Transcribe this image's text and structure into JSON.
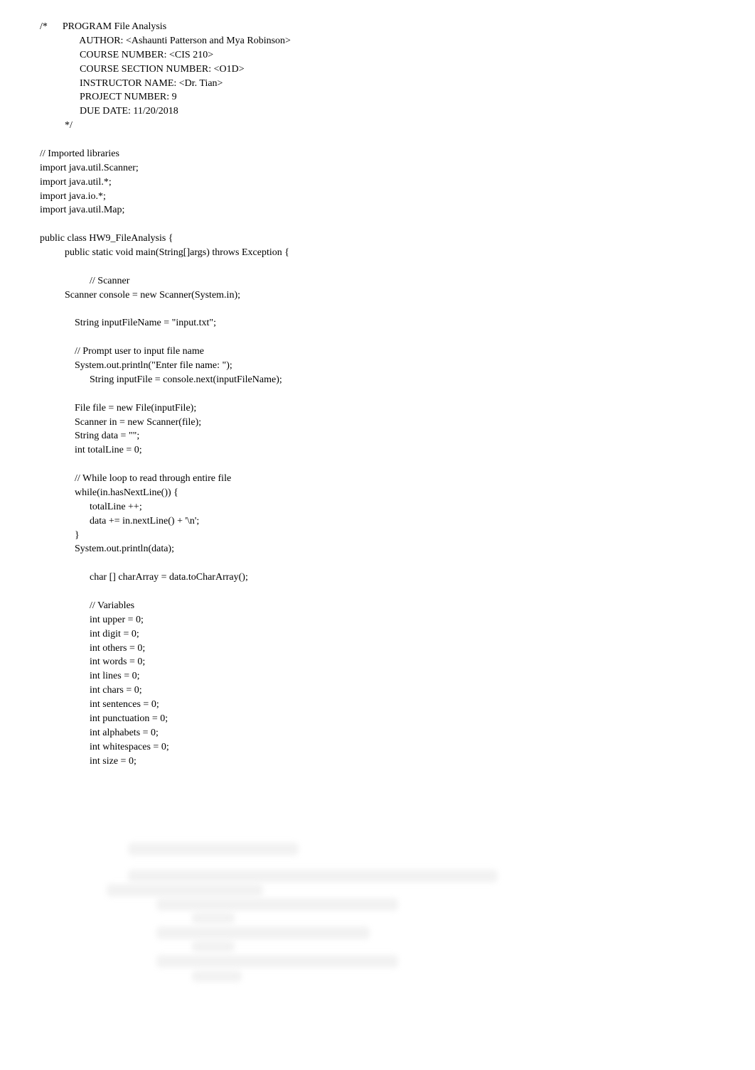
{
  "code": "/*      PROGRAM File Analysis\n                AUTHOR: <Ashaunti Patterson and Mya Robinson>\n                COURSE NUMBER: <CIS 210>\n                COURSE SECTION NUMBER: <O1D>\n                INSTRUCTOR NAME: <Dr. Tian>\n                PROJECT NUMBER: 9\n                DUE DATE: 11/20/2018\n          */\n\n// Imported libraries\nimport java.util.Scanner;\nimport java.util.*;\nimport java.io.*;\nimport java.util.Map;\n\npublic class HW9_FileAnalysis {\n          public static void main(String[]args) throws Exception {\n\n                    // Scanner\n          Scanner console = new Scanner(System.in);\n\n              String inputFileName = \"input.txt\";\n\n              // Prompt user to input file name\n              System.out.println(\"Enter file name: \");\n                    String inputFile = console.next(inputFileName);\n\n              File file = new File(inputFile);\n              Scanner in = new Scanner(file);\n              String data = \"\";\n              int totalLine = 0;\n\n              // While loop to read through entire file\n              while(in.hasNextLine()) {\n                    totalLine ++;\n                    data += in.nextLine() + '\\n';\n              }\n              System.out.println(data);\n\n                    char [] charArray = data.toCharArray();\n\n                    // Variables\n                    int upper = 0;\n                    int digit = 0;\n                    int others = 0;\n                    int words = 0;\n                    int lines = 0;\n                    int chars = 0;\n                    int sentences = 0;\n                    int punctuation = 0;\n                    int alphabets = 0;\n                    int whitespaces = 0;\n                    int size = 0;"
}
